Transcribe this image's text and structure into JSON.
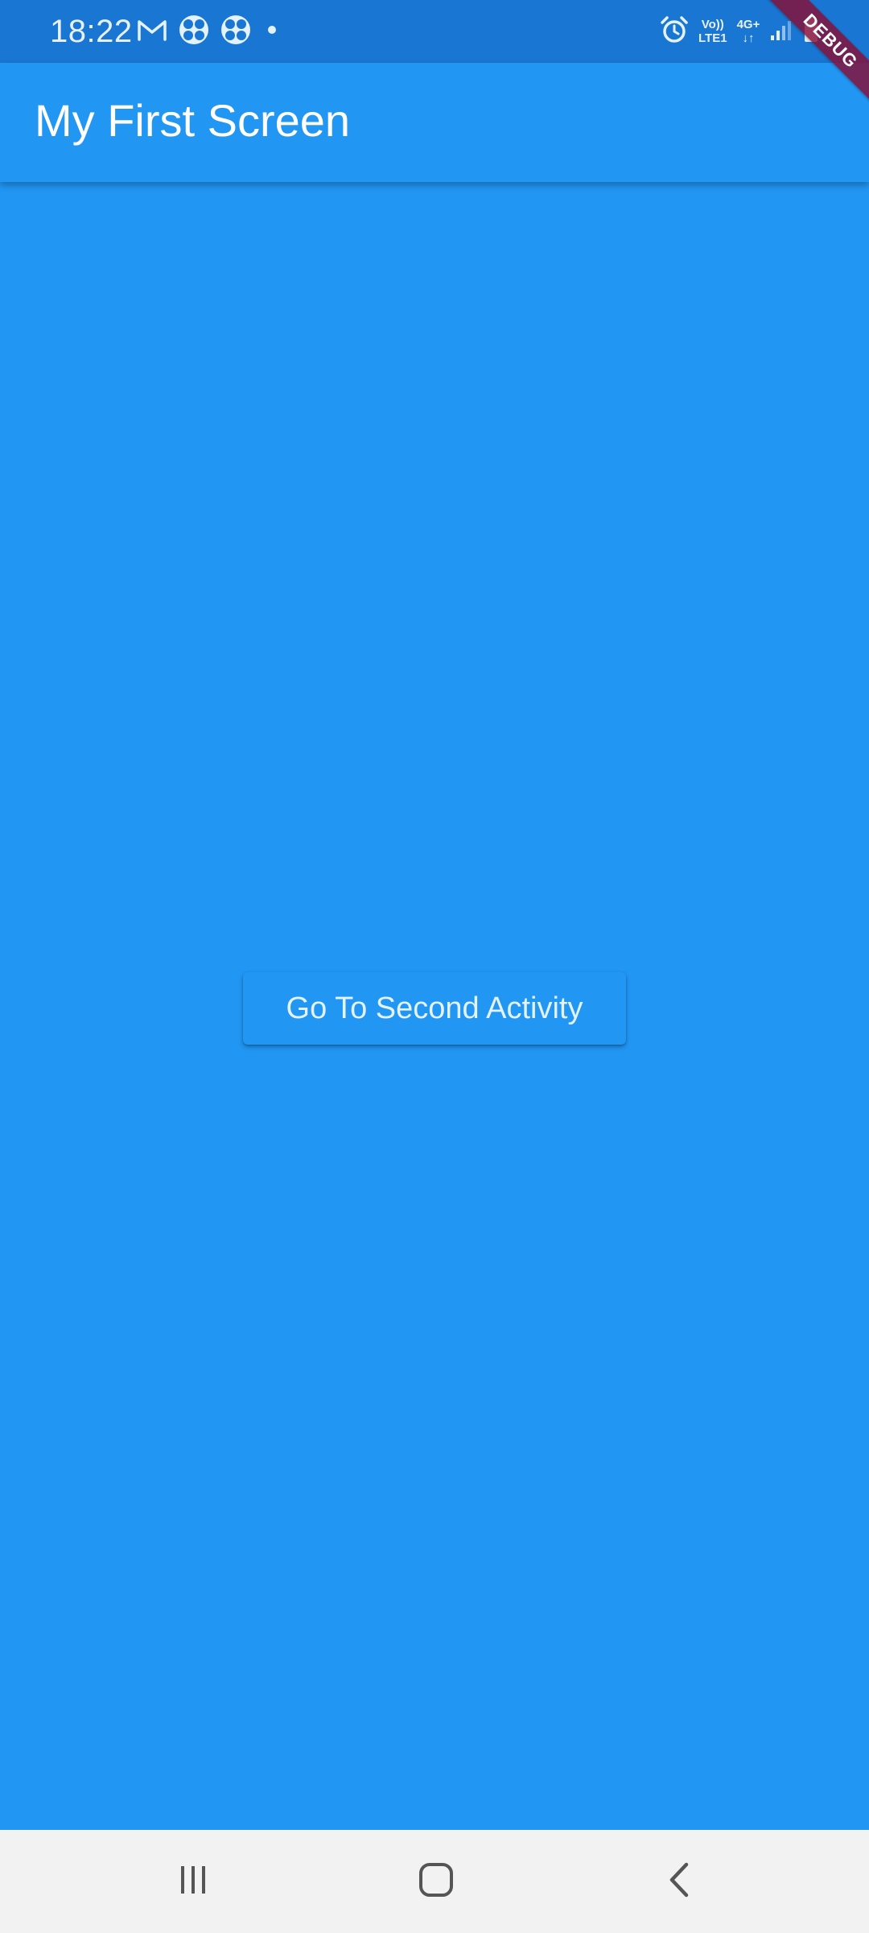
{
  "status_bar": {
    "time": "18:22",
    "network_top": "4G+",
    "volte_top": "Vo))",
    "volte_bottom": "LTE1",
    "left_icons": [
      "gmail-icon",
      "fan-icon",
      "fan-icon",
      "dot-icon"
    ],
    "right_icons": [
      "alarm-icon",
      "volte-indicator",
      "4g-indicator",
      "signal-icon",
      "battery-icon"
    ]
  },
  "app_bar": {
    "title": "My First Screen"
  },
  "debug_banner": {
    "label": "DEBUG"
  },
  "main": {
    "button_label": "Go To Second Activity"
  },
  "nav_bar": {
    "items": [
      "recents-icon",
      "home-icon",
      "back-icon"
    ]
  },
  "colors": {
    "primary": "#2196F3",
    "status_bar": "#1976D2",
    "nav_bar": "#F2F2F2",
    "debug": "#880E37"
  }
}
